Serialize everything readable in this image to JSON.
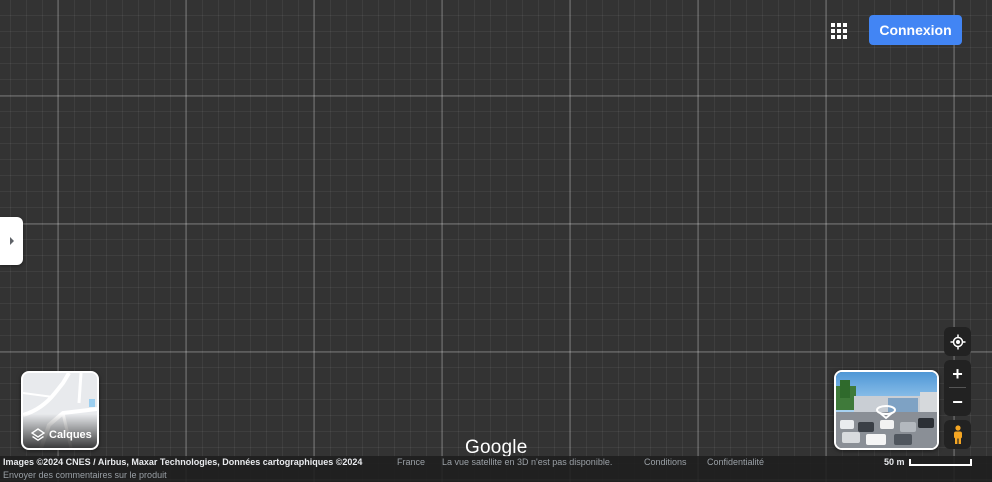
{
  "header": {
    "apps_icon": "apps-grid-icon",
    "login_label": "Connexion"
  },
  "layers": {
    "label": "Calques",
    "icon": "layers-icon"
  },
  "controls": {
    "locate_icon": "my-location-icon",
    "zoom_in_label": "+",
    "zoom_out_label": "−",
    "pegman_icon": "pegman-icon"
  },
  "branding": {
    "logo_text": "Google"
  },
  "attribution": {
    "images": "Images ©2024 CNES / Airbus, Maxar Technologies, Données cartographiques ©2024",
    "country": "France",
    "notice": "La vue satellite en 3D n'est pas disponible.",
    "terms": "Conditions",
    "privacy": "Confidentialité",
    "scale": "50 m",
    "feedback": "Envoyer des commentaires sur le produit"
  },
  "colors": {
    "accent": "#4285f4",
    "map_background": "#333333",
    "control_background": "#222222",
    "pegman": "#f5a623"
  }
}
